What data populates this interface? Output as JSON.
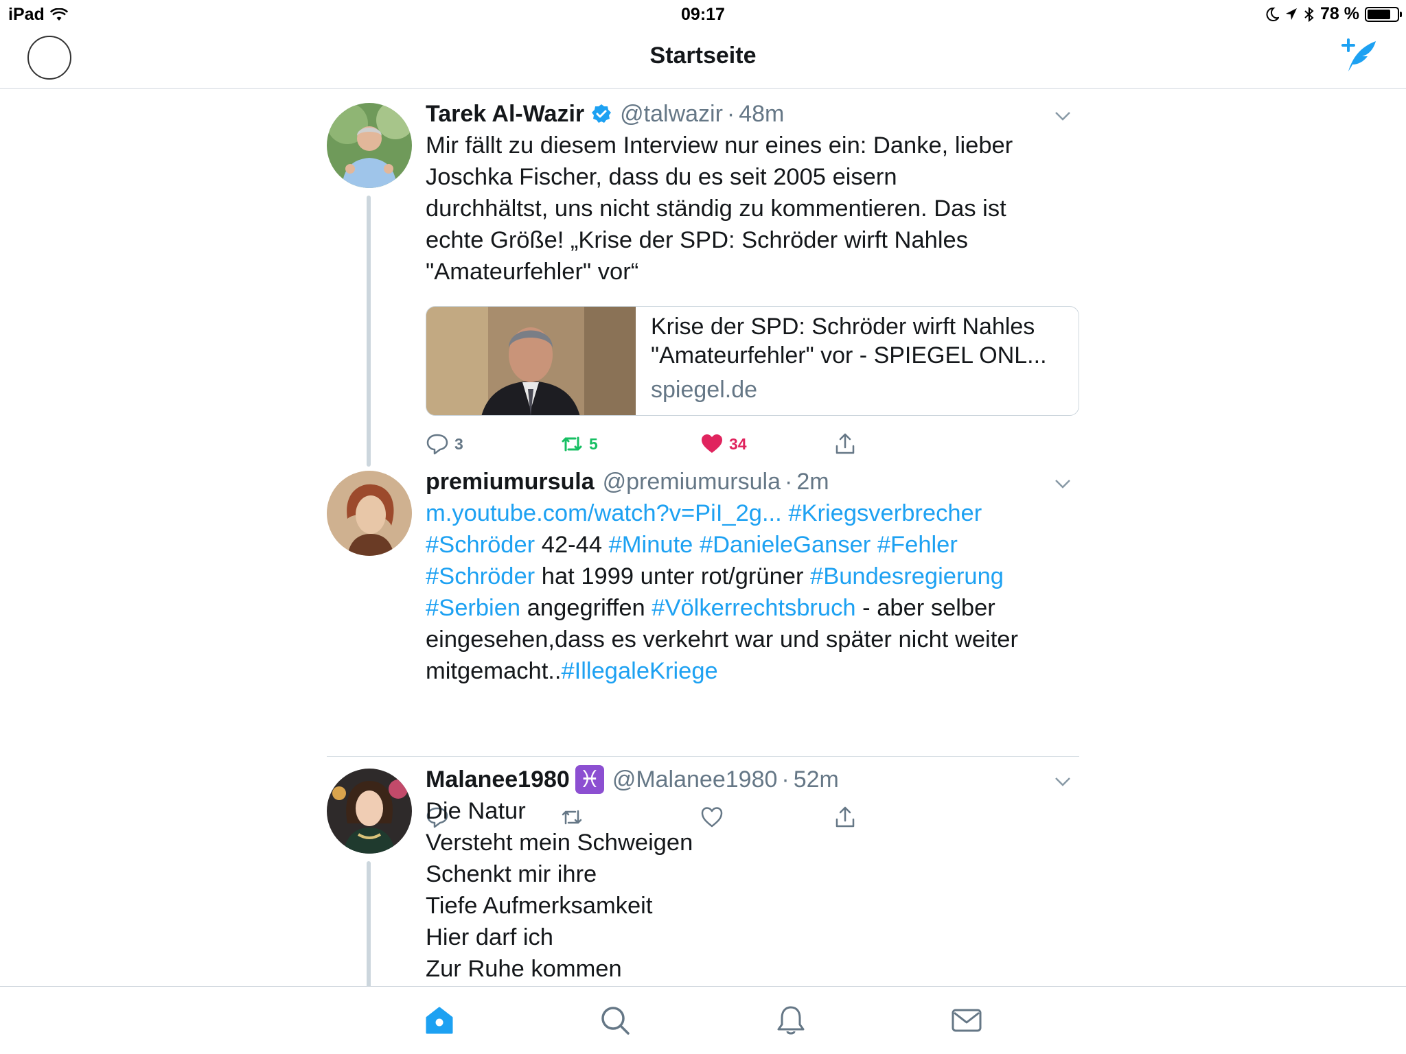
{
  "status_bar": {
    "device": "iPad",
    "time": "09:17",
    "battery": "78 %",
    "battery_level": 0.78
  },
  "nav": {
    "title": "Startseite"
  },
  "tweets": [
    {
      "name": "Tarek Al-Wazir",
      "verified": true,
      "handle": "@talwazir",
      "dot": "·",
      "time": "48m",
      "text_lines": [
        "Mir fällt zu diesem Interview nur eines ein: Danke, lieber",
        "Joschka Fischer, dass du es seit 2005 eisern",
        "durchhältst, uns nicht ständig zu kommentieren. Das ist",
        "echte Größe! „Krise der SPD: Schröder wirft Nahles",
        "\"Amateurfehler\" vor“"
      ],
      "card": {
        "title_line1": "Krise der SPD: Schröder wirft Nahles",
        "title_line2": "\"Amateurfehler\" vor - SPIEGEL ONL...",
        "domain": "spiegel.de"
      },
      "replies": "3",
      "retweets": "5",
      "likes": "34"
    },
    {
      "name": "premiumursula",
      "handle": "@premiumursula",
      "dot": "·",
      "time": "2m",
      "segments": [
        [
          {
            "t": "m.youtube.com/watch?v=PiI_2g...",
            "link": true
          },
          {
            "t": " ",
            "link": false
          },
          {
            "t": "#Kriegsverbrecher",
            "link": true
          }
        ],
        [
          {
            "t": "#Schröder",
            "link": true
          },
          {
            "t": " 42-44 ",
            "link": false
          },
          {
            "t": "#Minute",
            "link": true
          },
          {
            "t": " ",
            "link": false
          },
          {
            "t": "#DanieleGanser",
            "link": true
          },
          {
            "t": " ",
            "link": false
          },
          {
            "t": "#Fehler",
            "link": true
          }
        ],
        [
          {
            "t": "#Schröder",
            "link": true
          },
          {
            "t": " hat 1999 unter rot/grüner ",
            "link": false
          },
          {
            "t": "#Bundesregierung",
            "link": true
          }
        ],
        [
          {
            "t": "#Serbien",
            "link": true
          },
          {
            "t": " angegriffen ",
            "link": false
          },
          {
            "t": "#Völkerrechtsbruch",
            "link": true
          },
          {
            "t": " - aber selber",
            "link": false
          }
        ],
        [
          {
            "t": "eingesehen,dass es verkehrt war und später nicht weiter",
            "link": false
          }
        ],
        [
          {
            "t": "mitgemacht..",
            "link": false
          },
          {
            "t": "#IllegaleKriege",
            "link": true
          }
        ]
      ]
    },
    {
      "name": "Malanee1980",
      "zodiac": "♓",
      "handle": "@Malanee1980",
      "dot": "·",
      "time": "52m",
      "text_lines": [
        "Die Natur",
        "Versteht mein Schweigen",
        "Schenkt mir ihre",
        "Tiefe Aufmerksamkeit",
        "Hier darf ich",
        "Zur Ruhe kommen"
      ]
    }
  ],
  "colors": {
    "accent": "#1da1f2",
    "retweet": "#17bf63",
    "like": "#e0245e",
    "muted": "#657786"
  },
  "tabs": [
    "home-icon",
    "search-icon",
    "bell-icon",
    "mail-icon"
  ]
}
